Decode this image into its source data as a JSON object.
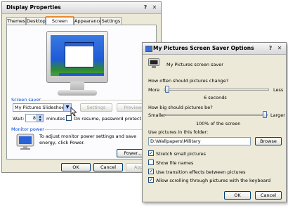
{
  "display_properties": {
    "title": "Display Properties",
    "help_label": "?",
    "close_label": "✕",
    "tabs": [
      {
        "label": "Themes"
      },
      {
        "label": "Desktop"
      },
      {
        "label": "Screen Saver"
      },
      {
        "label": "Appearance"
      },
      {
        "label": "Settings"
      }
    ],
    "active_tab": "Screen Saver",
    "screen_saver": {
      "group_label": "Screen saver",
      "selected": "My Pictures Slideshow",
      "settings_label": "Settings",
      "preview_label": "Preview",
      "wait_label": "Wait:",
      "wait_value": "8",
      "minutes_label": "minutes",
      "resume_label": "On resume, password protect",
      "resume_checked": false
    },
    "monitor_power": {
      "group_label": "Monitor power",
      "description": "To adjust monitor power settings and save energy, click Power.",
      "power_label": "Power..."
    },
    "footer": {
      "ok_label": "OK",
      "cancel_label": "Cancel",
      "apply_label": "Apply"
    }
  },
  "options": {
    "title": "My Pictures Screen Saver Options",
    "help_label": "?",
    "close_label": "✕",
    "header_label": "My Pictures screen saver",
    "change": {
      "question": "How often should pictures change?",
      "min_label": "More",
      "max_label": "Less",
      "value_text": "6 seconds",
      "position": 0.03
    },
    "size": {
      "question": "How big should pictures be?",
      "min_label": "Smaller",
      "max_label": "Larger",
      "value_text": "100% of the screen",
      "position": 0.97
    },
    "folder": {
      "label": "Use pictures in this folder:",
      "path": "D:\\Wallpapers\\Military",
      "browse_label": "Browse"
    },
    "checkboxes": [
      {
        "label": "Stretch small pictures",
        "checked": true
      },
      {
        "label": "Show file names",
        "checked": false
      },
      {
        "label": "Use transition effects between pictures",
        "checked": true
      },
      {
        "label": "Allow scrolling through pictures with the keyboard",
        "checked": true
      }
    ],
    "ok_label": "OK",
    "cancel_label": "Cancel"
  },
  "colors": {
    "group_label": "#0046d5",
    "active_tab_accent": "#e68b2c",
    "desktop_blue": "#1e5bd8"
  }
}
